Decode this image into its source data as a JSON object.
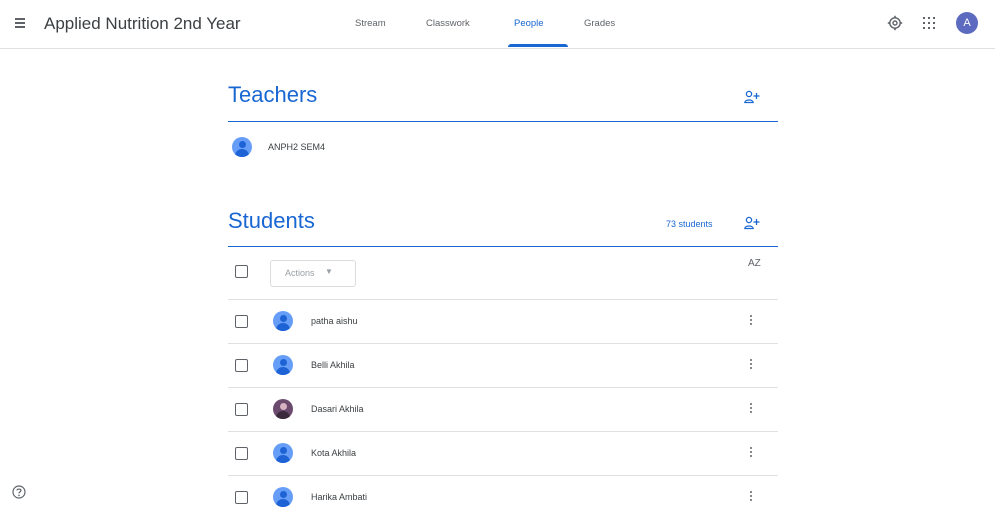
{
  "header": {
    "course_title": "Applied Nutrition 2nd Year",
    "tabs": [
      {
        "label": "Stream"
      },
      {
        "label": "Classwork"
      },
      {
        "label": "People",
        "active": true
      },
      {
        "label": "Grades"
      }
    ],
    "account_initial": "A",
    "icons": [
      "menu-icon",
      "settings-icon",
      "apps-grid-icon"
    ]
  },
  "teachers": {
    "title": "Teachers",
    "list": [
      {
        "name": "ANPH2 SEM4"
      }
    ]
  },
  "students": {
    "title": "Students",
    "count_label": "73 students",
    "actions_label": "Actions",
    "sort_label": "AZ",
    "list": [
      {
        "name": "patha aishu",
        "avatar": "default"
      },
      {
        "name": "Belli Akhila",
        "avatar": "default"
      },
      {
        "name": "Dasari Akhila",
        "avatar": "photo"
      },
      {
        "name": "Kota Akhila",
        "avatar": "default"
      },
      {
        "name": "Harika Ambati",
        "avatar": "default"
      }
    ]
  },
  "colors": {
    "accent": "#1967d2",
    "text": "#3c4043",
    "avatar_bg": "#669df6"
  }
}
